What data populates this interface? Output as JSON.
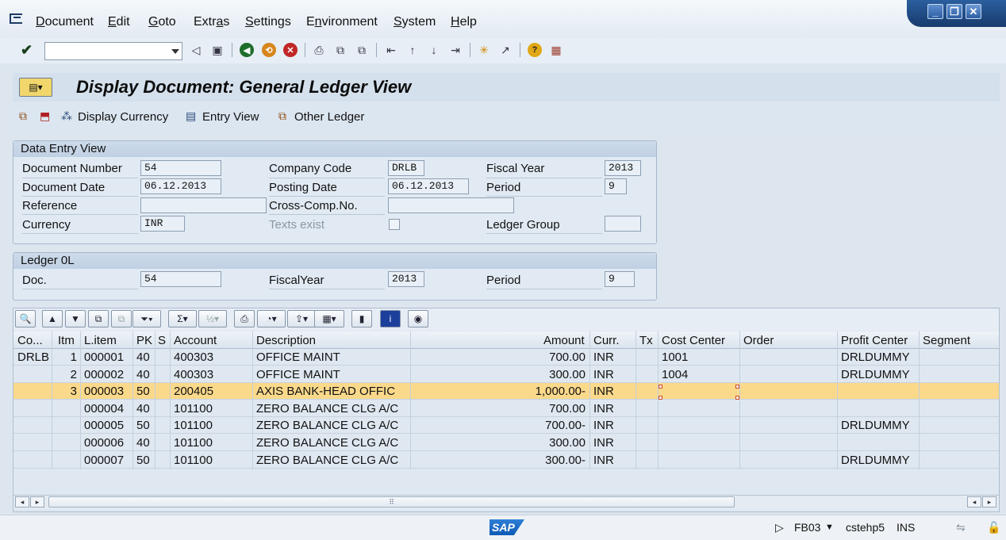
{
  "menu": {
    "items": [
      {
        "pre": "",
        "ul": "D",
        "post": "ocument"
      },
      {
        "pre": "",
        "ul": "E",
        "post": "dit"
      },
      {
        "pre": "",
        "ul": "G",
        "post": "oto"
      },
      {
        "pre": "Extr",
        "ul": "a",
        "post": "s"
      },
      {
        "pre": "",
        "ul": "S",
        "post": "ettings"
      },
      {
        "pre": "E",
        "ul": "n",
        "post": "vironment"
      },
      {
        "pre": "",
        "ul": "S",
        "post": "ystem"
      },
      {
        "pre": "",
        "ul": "H",
        "post": "elp"
      }
    ]
  },
  "command_field": {
    "value": ""
  },
  "title": "Display Document: General Ledger View",
  "app_toolbar": {
    "display_currency": "Display Currency",
    "entry_view": "Entry View",
    "other_ledger": "Other Ledger"
  },
  "data_entry_view": {
    "title": "Data Entry View",
    "document_number_label": "Document Number",
    "document_number": "54",
    "company_code_label": "Company Code",
    "company_code": "DRLB",
    "fiscal_year_label": "Fiscal Year",
    "fiscal_year": "2013",
    "document_date_label": "Document Date",
    "document_date": "06.12.2013",
    "posting_date_label": "Posting Date",
    "posting_date": "06.12.2013",
    "period_label": "Period",
    "period": "9",
    "reference_label": "Reference",
    "reference": "",
    "cross_comp_label": "Cross-Comp.No.",
    "cross_comp": "",
    "currency_label": "Currency",
    "currency": "INR",
    "texts_exist_label": "Texts exist",
    "ledger_group_label": "Ledger Group",
    "ledger_group": ""
  },
  "ledger": {
    "title": "Ledger 0L",
    "doc_label": "Doc.",
    "doc": "54",
    "fiscal_year_label": "FiscalYear",
    "fiscal_year": "2013",
    "period_label": "Period",
    "period": "9"
  },
  "grid": {
    "headers": {
      "co": "Co...",
      "itm": "Itm",
      "litem": "L.item",
      "pk": "PK",
      "s": "S",
      "account": "Account",
      "description": "Description",
      "amount": "Amount",
      "curr": "Curr.",
      "tx": "Tx",
      "cost_center": "Cost Center",
      "order": "Order",
      "profit_center": "Profit Center",
      "segment": "Segment"
    },
    "rows": [
      {
        "co": "DRLB",
        "itm": "1",
        "litem": "000001",
        "pk": "40",
        "s": "",
        "account": "400303",
        "description": "OFFICE MAINT",
        "amount": "700.00",
        "curr": "INR",
        "tx": "",
        "cost_center": "1001",
        "order": "",
        "profit_center": "DRLDUMMY",
        "segment": ""
      },
      {
        "co": "",
        "itm": "2",
        "litem": "000002",
        "pk": "40",
        "s": "",
        "account": "400303",
        "description": "OFFICE MAINT",
        "amount": "300.00",
        "curr": "INR",
        "tx": "",
        "cost_center": "1004",
        "order": "",
        "profit_center": "DRLDUMMY",
        "segment": ""
      },
      {
        "co": "",
        "itm": "3",
        "litem": "000003",
        "pk": "50",
        "s": "",
        "account": "200405",
        "description": "AXIS BANK-HEAD OFFIC",
        "amount": "1,000.00-",
        "curr": "INR",
        "tx": "",
        "cost_center": "",
        "order": "",
        "profit_center": "",
        "segment": ""
      },
      {
        "co": "",
        "itm": "",
        "litem": "000004",
        "pk": "40",
        "s": "",
        "account": "101100",
        "description": "ZERO BALANCE CLG A/C",
        "amount": "700.00",
        "curr": "INR",
        "tx": "",
        "cost_center": "",
        "order": "",
        "profit_center": "",
        "segment": ""
      },
      {
        "co": "",
        "itm": "",
        "litem": "000005",
        "pk": "50",
        "s": "",
        "account": "101100",
        "description": "ZERO BALANCE CLG A/C",
        "amount": "700.00-",
        "curr": "INR",
        "tx": "",
        "cost_center": "",
        "order": "",
        "profit_center": "DRLDUMMY",
        "segment": ""
      },
      {
        "co": "",
        "itm": "",
        "litem": "000006",
        "pk": "40",
        "s": "",
        "account": "101100",
        "description": "ZERO BALANCE CLG A/C",
        "amount": "300.00",
        "curr": "INR",
        "tx": "",
        "cost_center": "",
        "order": "",
        "profit_center": "",
        "segment": ""
      },
      {
        "co": "",
        "itm": "",
        "litem": "000007",
        "pk": "50",
        "s": "",
        "account": "101100",
        "description": "ZERO BALANCE CLG A/C",
        "amount": "300.00-",
        "curr": "INR",
        "tx": "",
        "cost_center": "",
        "order": "",
        "profit_center": "DRLDUMMY",
        "segment": ""
      }
    ],
    "selected_row": 2
  },
  "status": {
    "logo": "SAP",
    "transaction": "FB03",
    "server": "cstehp5",
    "mode": "INS"
  },
  "colors": {
    "selected_row": "#fbd98b",
    "background": "#dde6ef",
    "window_controls": "#173a6d"
  }
}
